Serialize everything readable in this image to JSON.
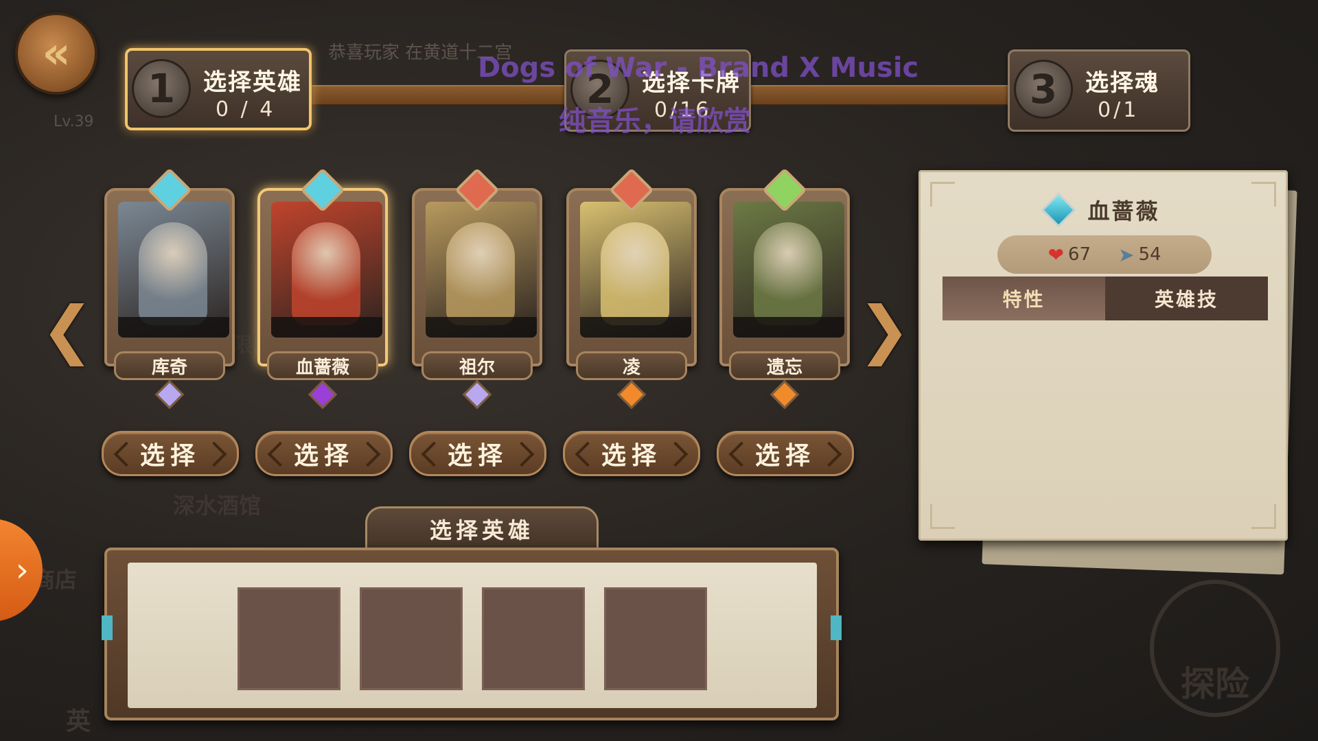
{
  "header": {
    "level": "Lv.39",
    "news_ticker": "恭喜玩家      在黄道十二宫",
    "music_title": "Dogs of War - Brand X Music",
    "music_subtitle": "纯音乐，请欣赏"
  },
  "steps": [
    {
      "num": "1",
      "title": "选择英雄",
      "count": "0 / 4"
    },
    {
      "num": "2",
      "title": "选择卡牌",
      "count": "0/16"
    },
    {
      "num": "3",
      "title": "选择魂",
      "count": "0/1"
    }
  ],
  "heroes": [
    {
      "name": "库奇",
      "class_icon": "shield-diamond-icon",
      "rarity": "purple-gem-icon",
      "class_color": "#5fd0e0",
      "gem_color": "#b8a8f0",
      "portrait_color": "#7b8894"
    },
    {
      "name": "血蔷薇",
      "class_icon": "shield-diamond-icon",
      "rarity": "violet-gem-icon",
      "class_color": "#5fd0e0",
      "gem_color": "#9a3fd8",
      "portrait_color": "#c0442c"
    },
    {
      "name": "祖尔",
      "class_icon": "sword-diamond-icon",
      "rarity": "purple-gem-icon",
      "class_color": "#e06a50",
      "gem_color": "#b8a8f0",
      "portrait_color": "#b89a5e"
    },
    {
      "name": "凌",
      "class_icon": "sword-diamond-icon",
      "rarity": "orange-gem-icon",
      "class_color": "#e06a50",
      "gem_color": "#f08a2a",
      "portrait_color": "#d8c070"
    },
    {
      "name": "遗忘",
      "class_icon": "heart-diamond-icon",
      "rarity": "orange-gem-icon",
      "class_color": "#8fd460",
      "gem_color": "#f08a2a",
      "portrait_color": "#6d7a45"
    }
  ],
  "select_label": "选择",
  "detail": {
    "name": "血蔷薇",
    "hp": "67",
    "speed": "54",
    "tabs": [
      "特性",
      "英雄技"
    ],
    "active_tab": "特性"
  },
  "tray": {
    "title": "选择英雄",
    "slots": 4
  },
  "background": {
    "tavern": "深水酒馆",
    "shop": "商店",
    "limit": "限",
    "explore": "探险",
    "hero": "英"
  },
  "colors": {
    "gold": "#f2c46a",
    "brown": "#6b421e",
    "parchment": "#e4dbc6"
  }
}
